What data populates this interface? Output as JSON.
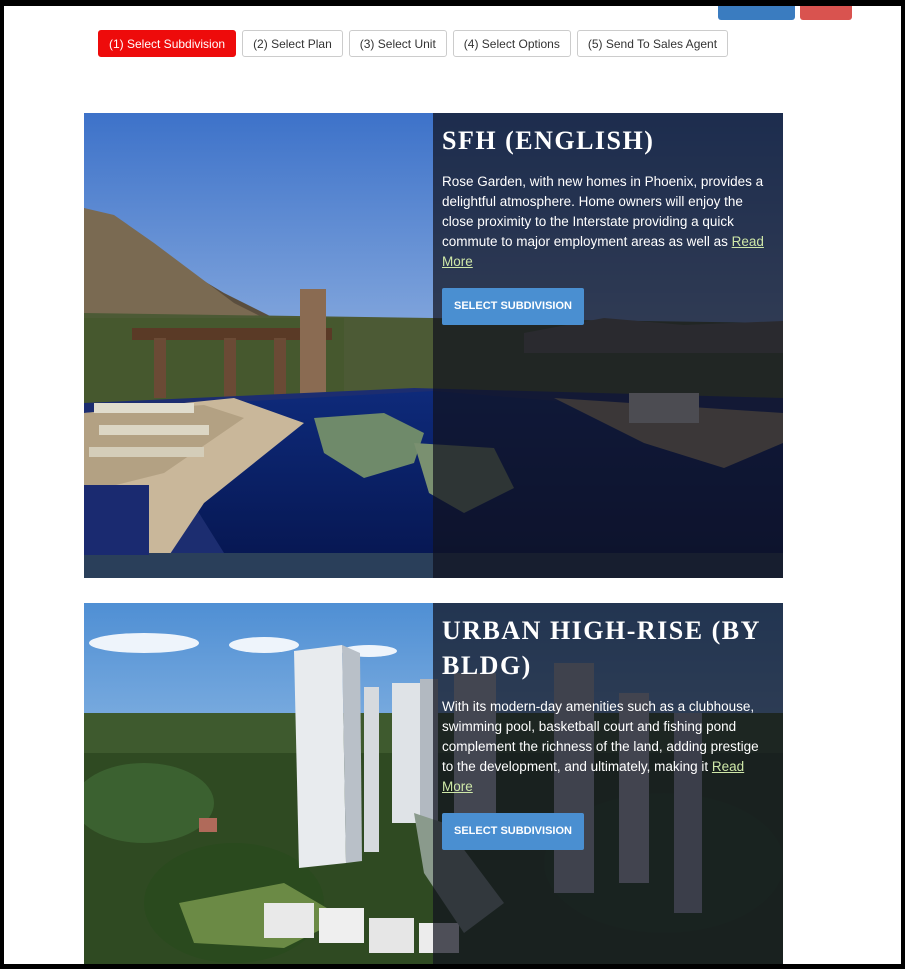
{
  "steps": [
    {
      "label": "(1) Select Subdivision",
      "active": true
    },
    {
      "label": "(2) Select Plan",
      "active": false
    },
    {
      "label": "(3) Select Unit",
      "active": false
    },
    {
      "label": "(4) Select Options",
      "active": false
    },
    {
      "label": "(5) Send To Sales Agent",
      "active": false
    }
  ],
  "cards": [
    {
      "title": "SFH (ENGLISH)",
      "description": "Rose Garden, with new homes in Phoenix, provides a delightful atmosphere. Home owners will enjoy the close proximity to the Interstate providing a quick commute to major employment areas as well as ",
      "read_more": "Read More",
      "button": "SELECT SUBDIVISION"
    },
    {
      "title": "URBAN HIGH-RISE (BY BLDG)",
      "description": "With its modern-day amenities such as a clubhouse, swimming pool, basketball court and fishing pond complement the richness of the land, adding prestige to the development, and ultimately, making it ",
      "read_more": "Read More",
      "button": "SELECT SUBDIVISION"
    }
  ],
  "colors": {
    "active_step": "#ee0b0b",
    "select_button": "#4a8fd1",
    "overlay": "#10121e"
  }
}
